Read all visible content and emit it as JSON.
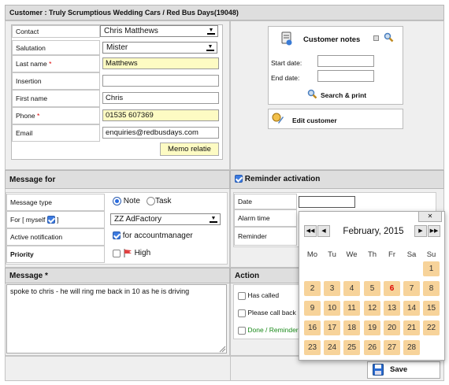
{
  "customer": {
    "header": "Customer : Truly Scrumptious Wedding Cars / Red Bus Days(19048)"
  },
  "contact_form": {
    "contact_label": "Contact",
    "contact_value": "Chris Matthews",
    "salutation_label": "Salutation",
    "salutation_value": "Mister",
    "lastname_label": "Last name",
    "lastname_value": "Matthews",
    "insertion_label": "Insertion",
    "insertion_value": "",
    "firstname_label": "First name",
    "firstname_value": "Chris",
    "phone_label": "Phone",
    "phone_value": "01535 607369",
    "email_label": "Email",
    "email_value": "enquiries@redbusdays.com",
    "memo_button": "Memo relatie",
    "required_mark": "*"
  },
  "notes_panel": {
    "notes_label": "Customer notes",
    "start_label": "Start date:",
    "end_label": "End date:",
    "search_label": "Search & print",
    "edit_label": "Edit customer"
  },
  "message_for": {
    "header": "Message for",
    "type_label": "Message type",
    "note_label": "Note",
    "task_label": "Task",
    "for_label": "For [ myself",
    "for_label_end": "]",
    "for_value": "ZZ AdFactory",
    "active_label": "Active notification",
    "active_value": "for accountmanager",
    "priority_label": "Priority",
    "priority_value": "High"
  },
  "reminder": {
    "header": "Reminder activation",
    "date_label": "Date",
    "alarm_label": "Alarm time",
    "reminder_label": "Reminder"
  },
  "message": {
    "header": "Message *",
    "text": "spoke to chris - he will ring me back in 10 as he is driving"
  },
  "action": {
    "header": "Action",
    "items": [
      "Has called",
      "Please call back",
      "Done / Reminder"
    ]
  },
  "save_button": "Save",
  "calendar": {
    "close": "✕",
    "month": "February, 2015",
    "weekdays": [
      "Mo",
      "Tu",
      "We",
      "Th",
      "Fr",
      "Sa",
      "Su"
    ],
    "days": [
      "1",
      "2",
      "3",
      "4",
      "5",
      "6",
      "7",
      "8",
      "9",
      "10",
      "11",
      "12",
      "13",
      "14",
      "15",
      "16",
      "17",
      "18",
      "19",
      "20",
      "21",
      "22",
      "23",
      "24",
      "25",
      "26",
      "27",
      "28"
    ],
    "today": "6"
  },
  "colors": {
    "required_yellow": "#fdfbc3",
    "day_cell": "#f7d39a",
    "check_blue": "#3d7be0"
  }
}
